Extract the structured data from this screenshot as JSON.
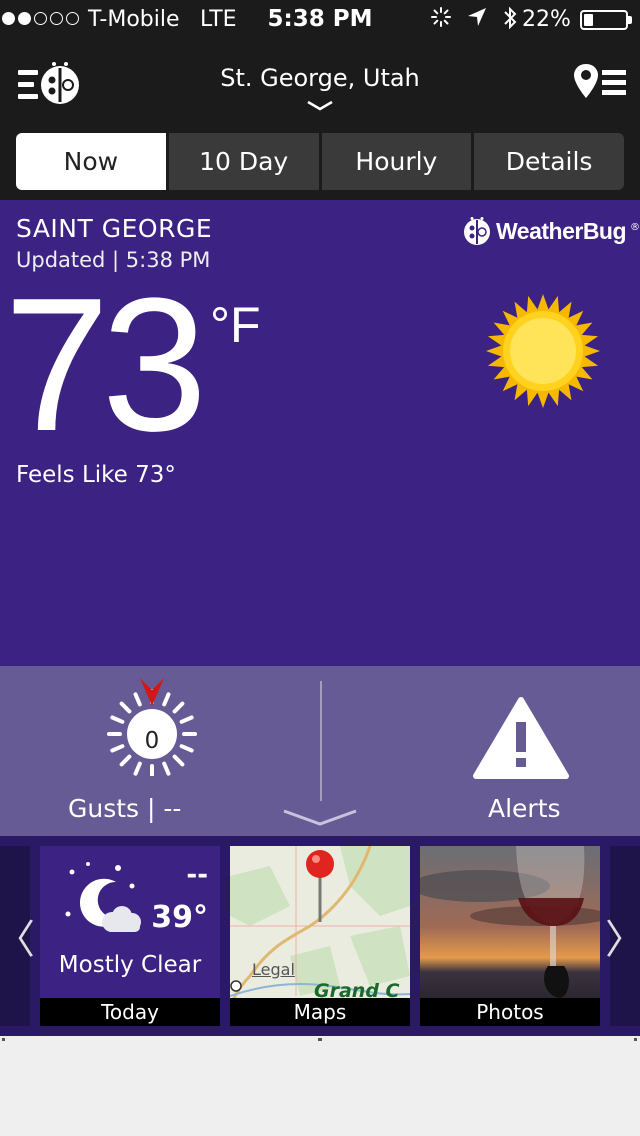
{
  "status_bar": {
    "carrier": "T-Mobile",
    "network": "LTE",
    "time": "5:38 PM",
    "battery_percent": "22%",
    "battery_level": 0.22,
    "signal_bars": 2
  },
  "nav": {
    "location": "St. George, Utah"
  },
  "tabs": [
    {
      "label": "Now",
      "selected": true
    },
    {
      "label": "10 Day",
      "selected": false
    },
    {
      "label": "Hourly",
      "selected": false
    },
    {
      "label": "Details",
      "selected": false
    }
  ],
  "current": {
    "station": "SAINT GEORGE",
    "updated": "Updated  |  5:38 PM",
    "temperature": "73",
    "unit": "°F",
    "feels_like": "Feels Like  73°",
    "brand": "WeatherBug",
    "brand_mark": "®",
    "condition_icon": "sun-icon"
  },
  "info": {
    "gust_value": "0",
    "gust_label": "Gusts  |  --",
    "alerts_label": "Alerts"
  },
  "tiles": {
    "today": {
      "hi": "--",
      "lo": "39°",
      "condition": "Mostly Clear",
      "caption": "Today"
    },
    "maps": {
      "legal": "Legal",
      "city": "Grand C",
      "caption": "Maps"
    },
    "photos": {
      "caption": "Photos"
    },
    "left_arrow": "〈",
    "right_arrow": "〉"
  },
  "colors": {
    "panel_purple": "#3c2283",
    "info_purple": "#665b94",
    "sun_yellow": "#f5c400",
    "gauge_arrow_red": "#d01818"
  }
}
